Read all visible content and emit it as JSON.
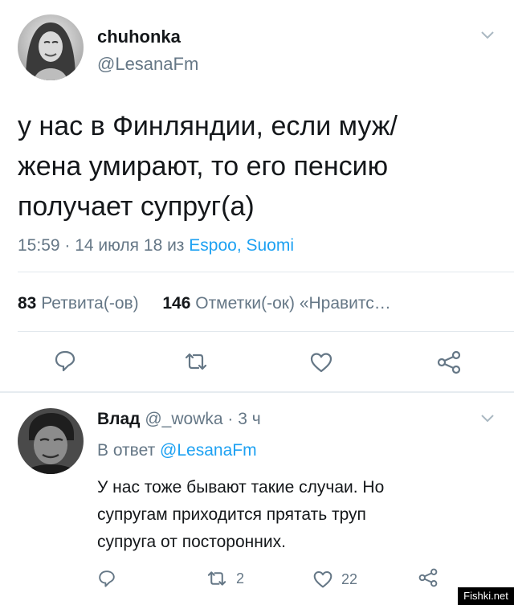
{
  "tweet": {
    "display_name": "chuhonka",
    "handle": "@LesanaFm",
    "text_lines": [
      "у нас в Финляндии, если муж/",
      "жена умирают, то его пенсию",
      "получает супруг(а)"
    ],
    "time": "15:59 · 14 июля 18 из ",
    "location": "Espoo, Suomi",
    "stats": {
      "retweets_count": "83",
      "retweets_label": "Ретвита(-ов)",
      "likes_count": "146",
      "likes_label": "Отметки(-ок) «Нравитс…"
    }
  },
  "reply": {
    "display_name": "Влад",
    "handle_time": "@_wowka · 3 ч",
    "in_reply_prefix": "В ответ ",
    "in_reply_handle": "@LesanaFm",
    "text_lines": [
      "У нас тоже бывают такие случаи. Но",
      "супругам приходится прятать труп",
      "супруга от посторонних."
    ],
    "retweet_count": "2",
    "like_count": "22"
  },
  "watermark": "Fishki.net",
  "colors": {
    "accent": "#1da1f2",
    "secondary": "#657786",
    "text": "#14171a"
  }
}
